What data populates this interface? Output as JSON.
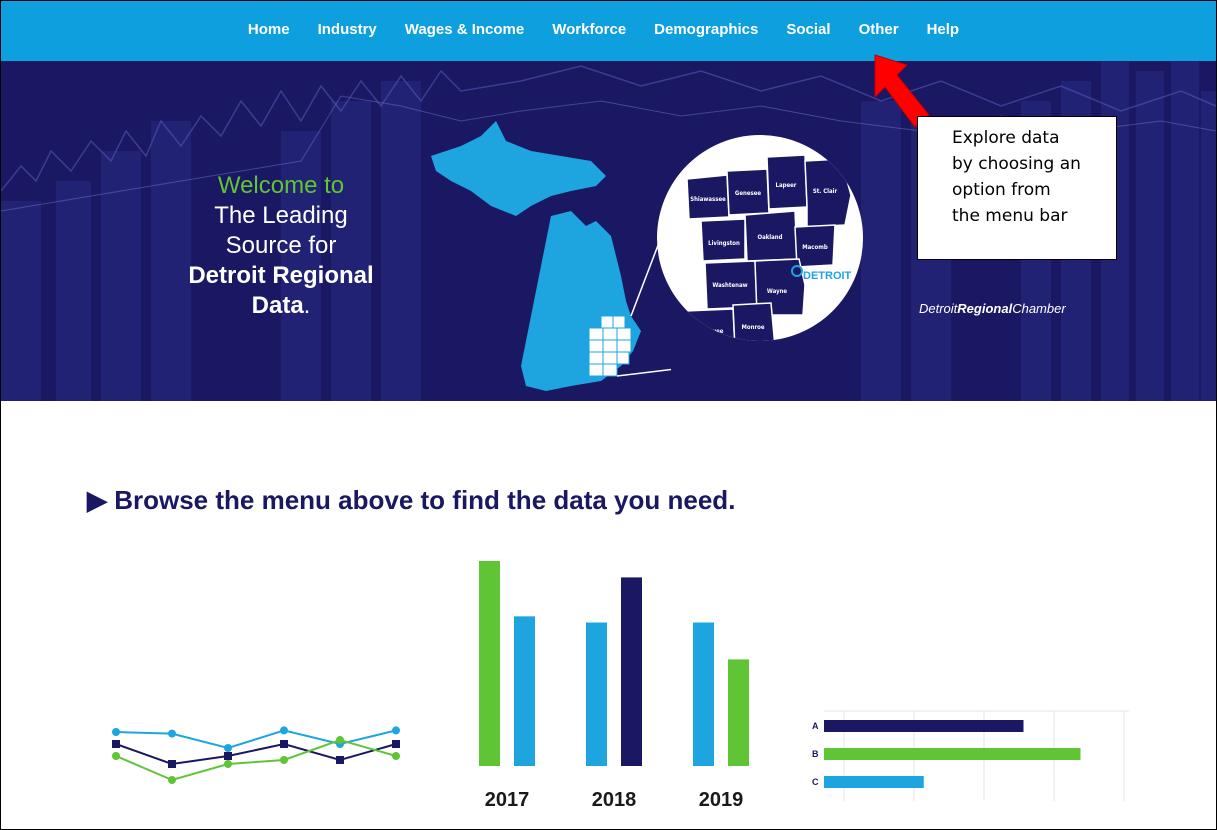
{
  "nav": {
    "items": [
      "Home",
      "Industry",
      "Wages & Income",
      "Workforce",
      "Demographics",
      "Social",
      "Other",
      "Help"
    ]
  },
  "hero": {
    "welcome_line": "Welcome to",
    "line2": "The Leading",
    "line3": "Source for",
    "line4": "Detroit Regional",
    "line5_bold": "Data",
    "line5_rest": ".",
    "map_marker": "DETROIT",
    "counties": [
      "Shiawassee",
      "Genesee",
      "Lapeer",
      "St. Clair",
      "Livingston",
      "Oakland",
      "Macomb",
      "Washtenaw",
      "Wayne",
      "Lenawee",
      "Monroe"
    ],
    "chamber_logo": {
      "part1": "Detroit",
      "part2": "Regional",
      "part3": "Chamber"
    }
  },
  "callout": {
    "text_lines": [
      "Explore data",
      "by choosing an",
      "option from",
      "the menu bar"
    ]
  },
  "content": {
    "heading": "▶ Browse the menu above to find the data you need."
  },
  "colors": {
    "nav_blue": "#0ea0de",
    "navy": "#1a1763",
    "green": "#5fc534",
    "arrow_red": "#ff0000"
  },
  "chart_data": [
    {
      "type": "line",
      "title": "",
      "x": [
        1,
        2,
        3,
        4,
        5,
        6
      ],
      "series": [
        {
          "values": [
            8,
            7.8,
            6,
            8.2,
            6.5,
            8.2
          ]
        },
        {
          "values": [
            6.5,
            4,
            5,
            6.5,
            4.5,
            6.5
          ]
        },
        {
          "values": [
            5,
            2,
            4,
            4.5,
            7,
            5
          ]
        }
      ]
    },
    {
      "type": "bar",
      "categories": [
        "2017",
        "2018",
        "2019"
      ],
      "series": [
        {
          "values": [
            100,
            70,
            70
          ]
        },
        {
          "values": [
            73,
            92,
            52
          ]
        }
      ]
    },
    {
      "type": "bar",
      "orientation": "horizontal",
      "categories": [
        "A",
        "B",
        "C"
      ],
      "values": [
        70,
        90,
        35
      ]
    }
  ]
}
